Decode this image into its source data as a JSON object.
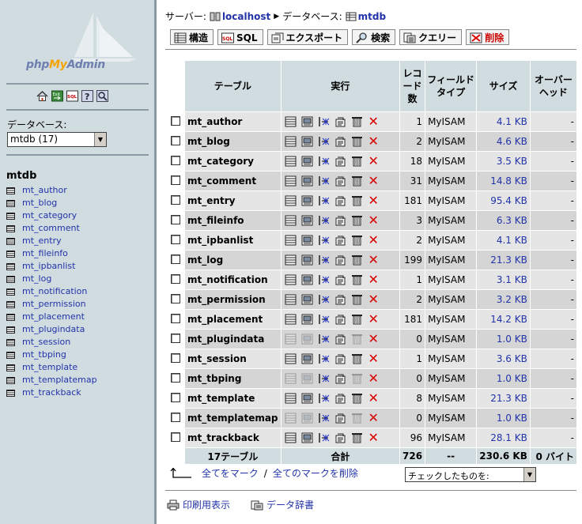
{
  "left": {
    "logo": {
      "php": "php",
      "my": "My",
      "admin": "Admin"
    },
    "icons": [
      "home-icon",
      "exit-icon",
      "sql-query-icon",
      "help-icon",
      "docs-icon"
    ],
    "db_label": "データベース:",
    "db_selected": "mtdb (17)",
    "db_name": "mtdb",
    "tables": [
      "mt_author",
      "mt_blog",
      "mt_category",
      "mt_comment",
      "mt_entry",
      "mt_fileinfo",
      "mt_ipbanlist",
      "mt_log",
      "mt_notification",
      "mt_permission",
      "mt_placement",
      "mt_plugindata",
      "mt_session",
      "mt_tbping",
      "mt_template",
      "mt_templatemap",
      "mt_trackback"
    ]
  },
  "crumb": {
    "server_label": "サーバー:",
    "server": "localhost",
    "db_label": "データベース:",
    "db": "mtdb"
  },
  "tabs": [
    {
      "label": "構造",
      "icon": "structure-icon"
    },
    {
      "label": "SQL",
      "icon": "sql-icon"
    },
    {
      "label": "エクスポート",
      "icon": "export-icon"
    },
    {
      "label": "検索",
      "icon": "search-icon"
    },
    {
      "label": "クエリー",
      "icon": "query-icon"
    },
    {
      "label": "削除",
      "icon": "drop-icon"
    }
  ],
  "table": {
    "headers": {
      "table": "テーブル",
      "action": "実行",
      "records": "レコード数",
      "field_type": "フィールドタイプ",
      "size": "サイズ",
      "overhead": "オーバーヘッド"
    },
    "rows": [
      {
        "name": "mt_author",
        "records": "1",
        "type": "MyISAM",
        "size": "4.1 KB",
        "overhead": "-",
        "empty": false
      },
      {
        "name": "mt_blog",
        "records": "2",
        "type": "MyISAM",
        "size": "4.6 KB",
        "overhead": "-",
        "empty": false
      },
      {
        "name": "mt_category",
        "records": "18",
        "type": "MyISAM",
        "size": "3.5 KB",
        "overhead": "-",
        "empty": false
      },
      {
        "name": "mt_comment",
        "records": "31",
        "type": "MyISAM",
        "size": "14.8 KB",
        "overhead": "-",
        "empty": false
      },
      {
        "name": "mt_entry",
        "records": "181",
        "type": "MyISAM",
        "size": "95.4 KB",
        "overhead": "-",
        "empty": false
      },
      {
        "name": "mt_fileinfo",
        "records": "3",
        "type": "MyISAM",
        "size": "6.3 KB",
        "overhead": "-",
        "empty": false
      },
      {
        "name": "mt_ipbanlist",
        "records": "2",
        "type": "MyISAM",
        "size": "4.1 KB",
        "overhead": "-",
        "empty": false
      },
      {
        "name": "mt_log",
        "records": "199",
        "type": "MyISAM",
        "size": "21.3 KB",
        "overhead": "-",
        "empty": false
      },
      {
        "name": "mt_notification",
        "records": "1",
        "type": "MyISAM",
        "size": "3.1 KB",
        "overhead": "-",
        "empty": false
      },
      {
        "name": "mt_permission",
        "records": "2",
        "type": "MyISAM",
        "size": "3.2 KB",
        "overhead": "-",
        "empty": false
      },
      {
        "name": "mt_placement",
        "records": "181",
        "type": "MyISAM",
        "size": "14.2 KB",
        "overhead": "-",
        "empty": false
      },
      {
        "name": "mt_plugindata",
        "records": "0",
        "type": "MyISAM",
        "size": "1.0 KB",
        "overhead": "-",
        "empty": true
      },
      {
        "name": "mt_session",
        "records": "1",
        "type": "MyISAM",
        "size": "3.6 KB",
        "overhead": "-",
        "empty": false
      },
      {
        "name": "mt_tbping",
        "records": "0",
        "type": "MyISAM",
        "size": "1.0 KB",
        "overhead": "-",
        "empty": true
      },
      {
        "name": "mt_template",
        "records": "8",
        "type": "MyISAM",
        "size": "21.3 KB",
        "overhead": "-",
        "empty": false
      },
      {
        "name": "mt_templatemap",
        "records": "0",
        "type": "MyISAM",
        "size": "1.0 KB",
        "overhead": "-",
        "empty": true
      },
      {
        "name": "mt_trackback",
        "records": "96",
        "type": "MyISAM",
        "size": "28.1 KB",
        "overhead": "-",
        "empty": false
      }
    ],
    "total": {
      "tables": "17テーブル",
      "sum_label": "合計",
      "records": "726",
      "type": "--",
      "size": "230.6 KB",
      "overhead": "0 バイト"
    }
  },
  "mark": {
    "check_all": "全てをマーク",
    "sep": "/",
    "uncheck_all": "全てのマークを削除",
    "with_selected": "チェックしたものを:"
  },
  "bottom": {
    "print": "印刷用表示",
    "dictionary": "データ辞書"
  },
  "colors": {
    "panel": "#d0dce0",
    "link": "#2233aa",
    "drop": "#d80000",
    "accent": "#f5a300"
  }
}
